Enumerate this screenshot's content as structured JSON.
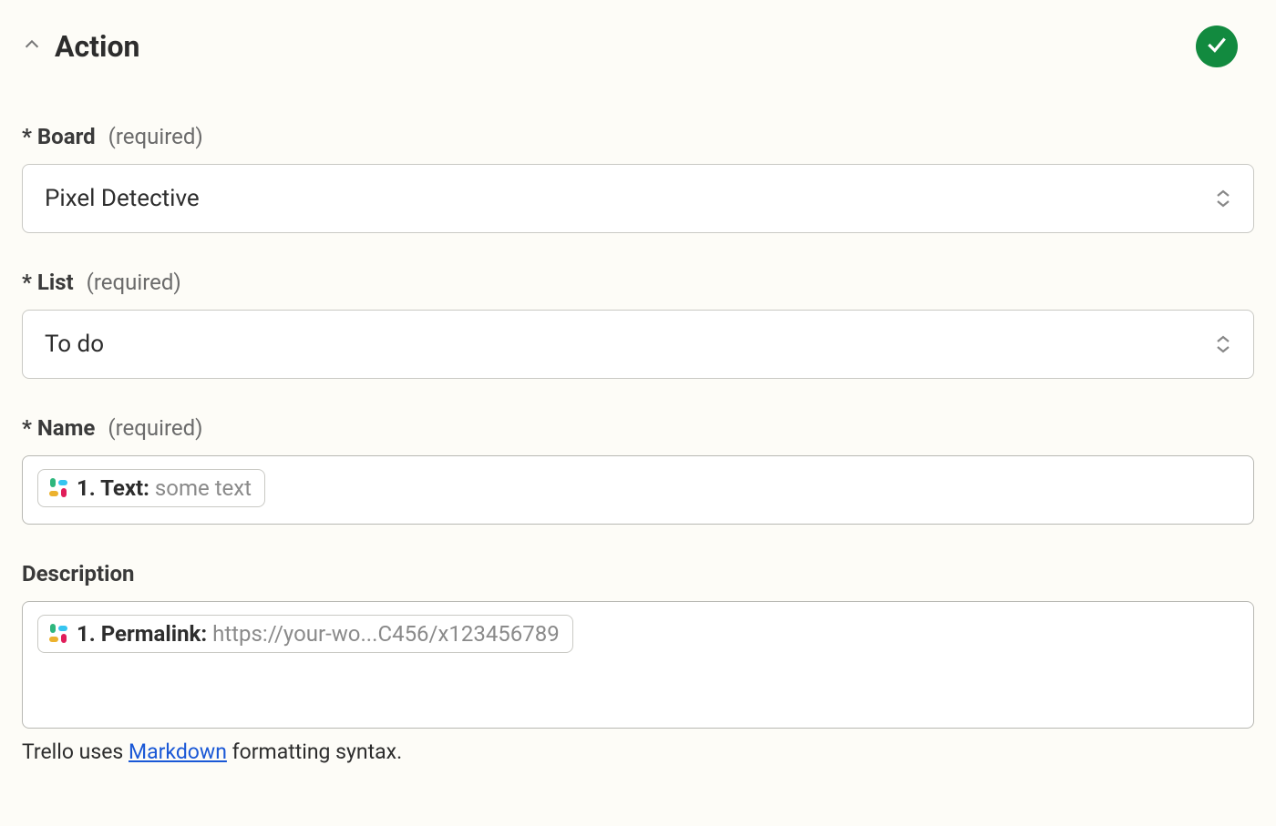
{
  "section": {
    "title": "Action"
  },
  "fields": {
    "board": {
      "label": "* Board",
      "required_text": "(required)",
      "value": "Pixel Detective"
    },
    "list": {
      "label": "* List",
      "required_text": "(required)",
      "value": "To do"
    },
    "name": {
      "label": "* Name",
      "required_text": "(required)",
      "pill_label": "1. Text: ",
      "pill_value": "some text"
    },
    "description": {
      "label": "Description",
      "pill_label": "1. Permalink: ",
      "pill_value": "https://your-wo...C456/x123456789"
    }
  },
  "helper": {
    "prefix": "Trello uses ",
    "link": "Markdown",
    "suffix": " formatting syntax."
  }
}
